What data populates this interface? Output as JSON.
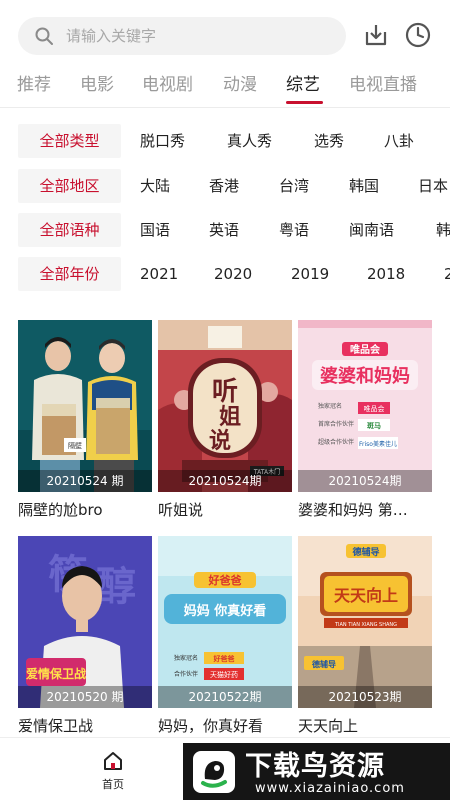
{
  "search": {
    "placeholder": "请输入关键字"
  },
  "toolbar": {
    "download_icon": "download-icon",
    "history_icon": "clock-icon"
  },
  "tabs": [
    {
      "label": "推荐"
    },
    {
      "label": "电影"
    },
    {
      "label": "电视剧"
    },
    {
      "label": "动漫"
    },
    {
      "label": "综艺",
      "active": true
    },
    {
      "label": "电视直播"
    }
  ],
  "accent_color": "#c8102e",
  "filters": {
    "type": {
      "all": "全部类型",
      "options": [
        "脱口秀",
        "真人秀",
        "选秀",
        "八卦"
      ]
    },
    "region": {
      "all": "全部地区",
      "options": [
        "大陆",
        "香港",
        "台湾",
        "韩国",
        "日本"
      ]
    },
    "language": {
      "all": "全部语种",
      "options": [
        "国语",
        "英语",
        "粤语",
        "闽南语",
        "韩"
      ]
    },
    "year": {
      "all": "全部年份",
      "options": [
        "2021",
        "2020",
        "2019",
        "2018",
        "2"
      ]
    }
  },
  "cards": [
    {
      "title": "隔壁的尬bro",
      "episode": "20210524 期",
      "poster_text": "隔壁的尬bro"
    },
    {
      "title": "听姐说",
      "episode": "20210524期",
      "poster_text": "听姐说",
      "poster_sub": "TATA木门"
    },
    {
      "title": "婆婆和妈妈 第…",
      "episode": "20210524期",
      "poster_text": "婆婆和妈妈",
      "poster_brand": "唯品会",
      "poster_lines": [
        "独家冠名",
        "首席合作伙伴",
        "超级合作伙伴"
      ],
      "poster_sponsor1": "唯品会",
      "poster_sponsor2": "斑马",
      "poster_sponsor3": "Friso美素佳儿"
    },
    {
      "title": "爱情保卫战",
      "episode": "20210520 期",
      "poster_text": "爱情保卫战",
      "poster_big": "筷子醇"
    },
    {
      "title": "妈妈，你真好看",
      "episode": "20210522期",
      "poster_text": "妈妈 你真好看",
      "poster_brand": "好爸爸",
      "poster_lines": [
        "独家冠名",
        "合作伙伴"
      ],
      "poster_sponsor1": "好爸爸",
      "poster_sponsor2": "天猫好药"
    },
    {
      "title": "天天向上",
      "episode": "20210523期",
      "poster_text": "天天向上",
      "poster_brand": "德辅导",
      "poster_sub": "TIAN TIAN XIANG SHANG",
      "poster_sponsor1": "德辅导"
    }
  ],
  "bottom_nav": {
    "home_label": "首页"
  },
  "watermark": {
    "title": "下载鸟资源",
    "url": "www.xiazainiao.com"
  }
}
